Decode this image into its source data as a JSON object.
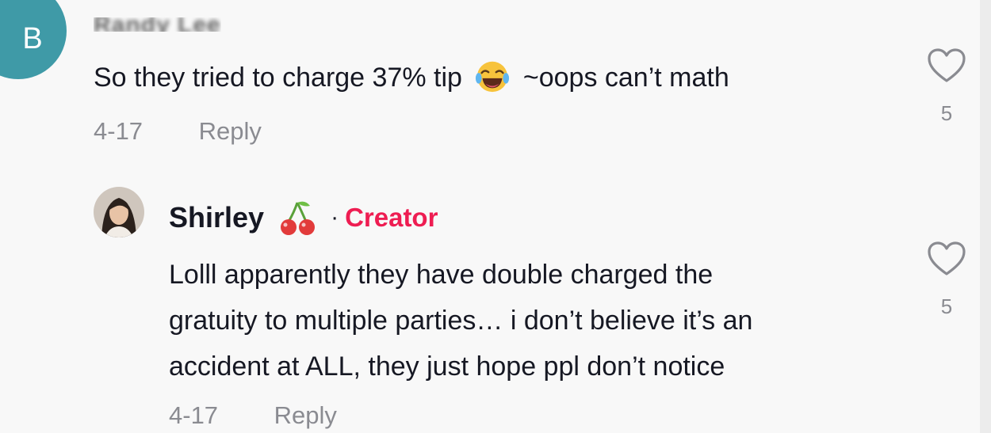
{
  "comments": [
    {
      "avatar_letter": "B",
      "author": "Randy Lee",
      "text_before_emoji": "So they tried to charge 37% tip",
      "emoji_icon": "face-with-tears-of-joy-emoji",
      "text_after_emoji": "~oops can’t math",
      "date": "4-17",
      "reply_label": "Reply",
      "likes": "5"
    }
  ],
  "reply": {
    "author": "Shirley",
    "author_icon": "cherry-icon",
    "separator": "·",
    "badge": "Creator",
    "text_lines": [
      "Lolll apparently they have double charged the",
      "gratuity to multiple parties… i don’t believe it’s an",
      "accident at ALL, they just hope ppl don’t notice"
    ],
    "date": "4-17",
    "reply_label": "Reply",
    "likes": "5"
  },
  "colors": {
    "avatar_bg": "#3f9aa7",
    "creator_accent": "#ee1d52",
    "muted_text": "#8a8b91",
    "primary_text": "#161823"
  }
}
